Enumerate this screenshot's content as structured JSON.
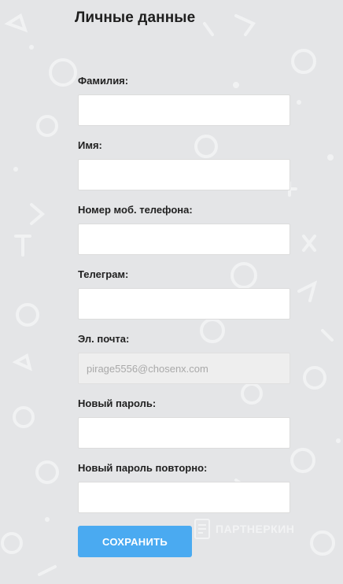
{
  "page": {
    "title": "Личные данные"
  },
  "form": {
    "fields": [
      {
        "label": "Фамилия:",
        "value": "",
        "placeholder": ""
      },
      {
        "label": "Имя:",
        "value": "",
        "placeholder": ""
      },
      {
        "label": "Номер моб. телефона:",
        "value": "",
        "placeholder": ""
      },
      {
        "label": "Телеграм:",
        "value": "",
        "placeholder": ""
      },
      {
        "label": "Эл. почта:",
        "value": "",
        "placeholder": "pirage5556@chosenx.com"
      },
      {
        "label": "Новый пароль:",
        "value": "",
        "placeholder": ""
      },
      {
        "label": "Новый пароль повторно:",
        "value": "",
        "placeholder": ""
      }
    ],
    "save_label": "СОХРАНИТЬ"
  },
  "watermark": {
    "text": "ПАРТНЕРКИН"
  },
  "colors": {
    "background": "#e4e5e7",
    "button": "#4aaaf1",
    "input_disabled_bg": "#eeeeee"
  }
}
